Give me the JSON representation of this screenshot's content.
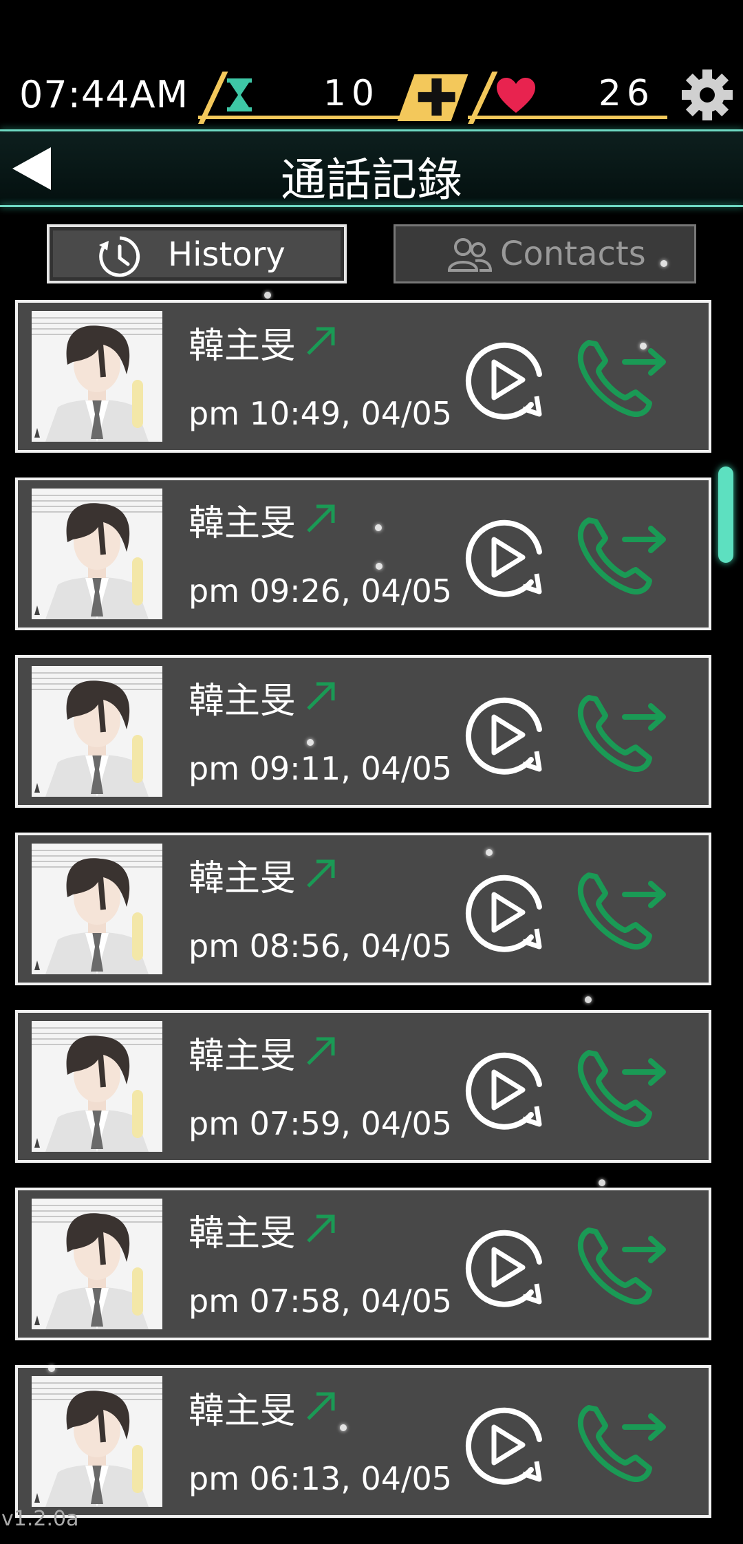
{
  "status": {
    "time": "07:44AM",
    "hourglass_value": "10",
    "heart_value": "26"
  },
  "header": {
    "title": "通話記錄"
  },
  "tabs": [
    {
      "label": "History"
    },
    {
      "label": "Contacts"
    }
  ],
  "calls": [
    {
      "name": "韓主旻",
      "time": "pm 10:49, 04/05"
    },
    {
      "name": "韓主旻",
      "time": "pm 09:26, 04/05"
    },
    {
      "name": "韓主旻",
      "time": "pm 09:11, 04/05"
    },
    {
      "name": "韓主旻",
      "time": "pm 08:56, 04/05"
    },
    {
      "name": "韓主旻",
      "time": "pm 07:59, 04/05"
    },
    {
      "name": "韓主旻",
      "time": "pm 07:58, 04/05"
    },
    {
      "name": "韓主旻",
      "time": "pm 06:13, 04/05"
    }
  ],
  "version": "v1.2.0a",
  "icons": {
    "hourglass": "hourglass-icon",
    "plus": "plus-icon",
    "heart": "heart-icon",
    "settings": "gear-icon",
    "back": "back-arrow-icon",
    "history": "clock-icon",
    "contacts": "contacts-icon",
    "outgoing": "outgoing-arrow-icon",
    "replay": "replay-icon",
    "call": "phone-call-icon"
  },
  "colors": {
    "accent": "#6fd9c3",
    "gold": "#f3c85b",
    "heart": "#e8234f",
    "call_green": "#1a9a55",
    "card": "#484848"
  }
}
